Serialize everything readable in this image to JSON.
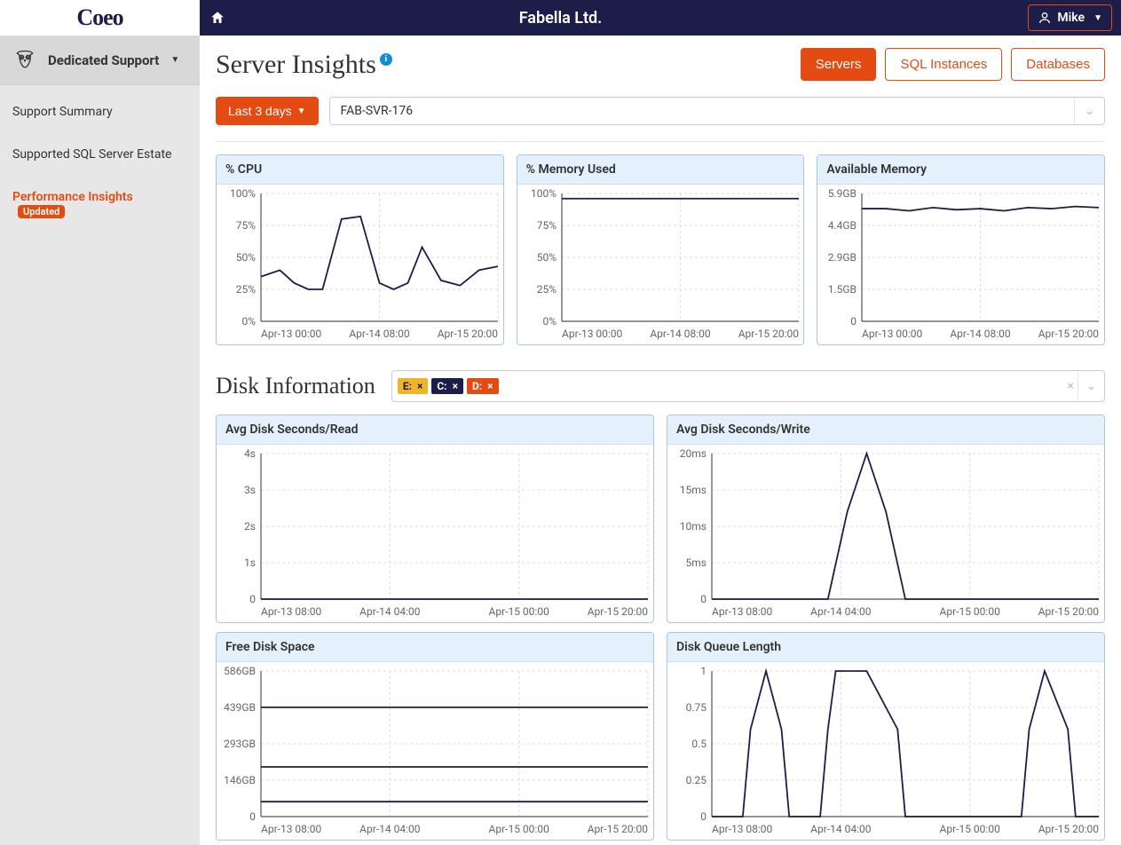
{
  "brand": "Coeo",
  "header": {
    "company": "Fabella Ltd.",
    "user": "Mike"
  },
  "sidebar": {
    "group_label": "Dedicated Support",
    "items": [
      {
        "label": "Support Summary"
      },
      {
        "label": "Supported SQL Server Estate"
      },
      {
        "label": "Performance Insights",
        "badge": "Updated"
      }
    ]
  },
  "page": {
    "title": "Server Insights",
    "tabs": {
      "servers": "Servers",
      "sql": "SQL Instances",
      "db": "Databases"
    },
    "range": "Last 3 days",
    "server_selected": "FAB-SVR-176"
  },
  "disk_section": {
    "title": "Disk Information",
    "chips": [
      {
        "label": "E:",
        "class": "chip-e"
      },
      {
        "label": "C:",
        "class": "chip-c"
      },
      {
        "label": "D:",
        "class": "chip-d"
      }
    ]
  },
  "chart_data": [
    {
      "id": "cpu",
      "title": "% CPU",
      "type": "line",
      "y_ticks": [
        "0%",
        "25%",
        "50%",
        "75%",
        "100%"
      ],
      "x_ticks": [
        "Apr-13 00:00",
        "Apr-14 08:00",
        "Apr-15 20:00"
      ],
      "x": [
        0,
        8,
        14,
        20,
        26,
        34,
        42,
        50,
        56,
        62,
        68,
        76,
        84,
        92,
        100
      ],
      "series": [
        {
          "name": "cpu",
          "color": "#1d1d4a",
          "values": [
            35,
            40,
            30,
            25,
            25,
            80,
            82,
            30,
            25,
            30,
            58,
            32,
            28,
            40,
            43
          ]
        }
      ],
      "ylim": [
        0,
        100
      ]
    },
    {
      "id": "mem_used",
      "title": "% Memory Used",
      "type": "line",
      "y_ticks": [
        "0%",
        "25%",
        "50%",
        "75%",
        "100%"
      ],
      "x_ticks": [
        "Apr-13 00:00",
        "Apr-14 08:00",
        "Apr-15 20:00"
      ],
      "x": [
        0,
        100
      ],
      "series": [
        {
          "name": "mem",
          "color": "#1d1d4a",
          "values": [
            96,
            96
          ]
        }
      ],
      "ylim": [
        0,
        100
      ]
    },
    {
      "id": "mem_avail",
      "title": "Available Memory",
      "type": "line",
      "y_ticks": [
        "0",
        "1.5GB",
        "2.9GB",
        "4.4GB",
        "5.9GB"
      ],
      "x_ticks": [
        "Apr-13 00:00",
        "Apr-14 08:00",
        "Apr-15 20:00"
      ],
      "x": [
        0,
        10,
        20,
        30,
        40,
        50,
        60,
        70,
        80,
        90,
        100
      ],
      "series": [
        {
          "name": "avail",
          "color": "#1d1d4a",
          "values": [
            5.2,
            5.2,
            5.1,
            5.25,
            5.15,
            5.2,
            5.1,
            5.25,
            5.2,
            5.3,
            5.25
          ]
        }
      ],
      "ylim": [
        0,
        5.9
      ]
    },
    {
      "id": "disk_read",
      "title": "Avg Disk Seconds/Read",
      "type": "line",
      "y_ticks": [
        "0",
        "1s",
        "2s",
        "3s",
        "4s"
      ],
      "x_ticks": [
        "Apr-13 08:00",
        "Apr-14 04:00",
        "Apr-15 00:00",
        "Apr-15 20:00"
      ],
      "x": [
        0,
        100
      ],
      "series": [
        {
          "name": "read",
          "color": "#1d1d4a",
          "values": [
            0,
            0
          ]
        }
      ],
      "ylim": [
        0,
        4
      ]
    },
    {
      "id": "disk_write",
      "title": "Avg Disk Seconds/Write",
      "type": "line",
      "y_ticks": [
        "0",
        "5ms",
        "10ms",
        "15ms",
        "20ms"
      ],
      "x_ticks": [
        "Apr-13 08:00",
        "Apr-14 04:00",
        "Apr-15 00:00",
        "Apr-15 20:00"
      ],
      "x": [
        0,
        30,
        35,
        40,
        45,
        50,
        100
      ],
      "series": [
        {
          "name": "write",
          "color": "#1d1d4a",
          "values": [
            0,
            0,
            12,
            20,
            12,
            0,
            0
          ]
        }
      ],
      "ylim": [
        0,
        20
      ]
    },
    {
      "id": "free_space",
      "title": "Free Disk Space",
      "type": "line",
      "y_ticks": [
        "0",
        "146GB",
        "293GB",
        "439GB",
        "586GB"
      ],
      "x_ticks": [
        "Apr-13 08:00",
        "Apr-14 04:00",
        "Apr-15 00:00",
        "Apr-15 20:00"
      ],
      "x": [
        0,
        100
      ],
      "series": [
        {
          "name": "E",
          "color": "#f0b429",
          "values": [
            440,
            440
          ]
        },
        {
          "name": "C",
          "color": "#1d1d4a",
          "values": [
            200,
            200
          ]
        },
        {
          "name": "D",
          "color": "#e34b12",
          "values": [
            60,
            60
          ]
        }
      ],
      "ylim": [
        0,
        586
      ]
    },
    {
      "id": "queue",
      "title": "Disk Queue Length",
      "type": "line",
      "y_ticks": [
        "0",
        "0.25",
        "0.5",
        "0.75",
        "1"
      ],
      "x_ticks": [
        "Apr-13 08:00",
        "Apr-14 04:00",
        "Apr-15 00:00",
        "Apr-15 20:00"
      ],
      "x": [
        0,
        8,
        10,
        14,
        18,
        20,
        28,
        30,
        32,
        40,
        48,
        50,
        56,
        80,
        82,
        86,
        92,
        94,
        100
      ],
      "series": [
        {
          "name": "q",
          "color": "#1d1d4a",
          "values": [
            0,
            0,
            0.6,
            1,
            0.6,
            0,
            0,
            0.6,
            1,
            1,
            0.6,
            0,
            0,
            0,
            0.6,
            1,
            0.6,
            0,
            0
          ]
        }
      ],
      "ylim": [
        0,
        1
      ]
    }
  ]
}
